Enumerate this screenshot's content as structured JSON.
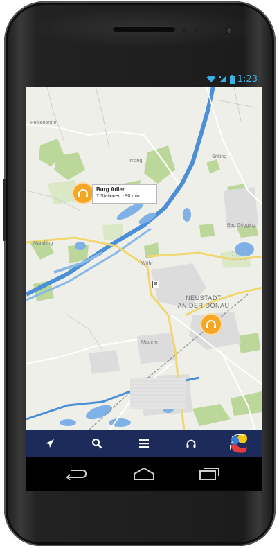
{
  "status_bar": {
    "time": "1:23",
    "icons": [
      "wifi-icon",
      "signal-icon",
      "battery-icon"
    ],
    "accent": "#3cb0e6"
  },
  "map": {
    "labels": {
      "pelkenbrunn": "Pelkenbrunn",
      "irrsing": "Irrsing",
      "sittling": "Sittling",
      "bad_goegging": "Bad Gögging",
      "mandling": "Mandling",
      "woehr": "Wöhr",
      "neustadt": "NEUSTADT",
      "an_der_donau": "AN DER DONAU",
      "mauern": "Mauern"
    },
    "callout": {
      "title": "Burg Adler",
      "subtitle": "7 Stationen - 90 min"
    },
    "poi_glyph": "⊠"
  },
  "bottom_nav": {
    "items": [
      "location-arrow-icon",
      "search-icon",
      "menu-icon",
      "headphones-icon",
      "app-logo-icon"
    ],
    "background": "#1c2b5a"
  },
  "system_nav": {
    "items": [
      "back-icon",
      "home-icon",
      "recent-apps-icon"
    ]
  },
  "colors": {
    "pin": "#f5a623",
    "river": "#4c8fd6",
    "forest": "#bcd79a",
    "road_major": "#f6e6a0"
  }
}
